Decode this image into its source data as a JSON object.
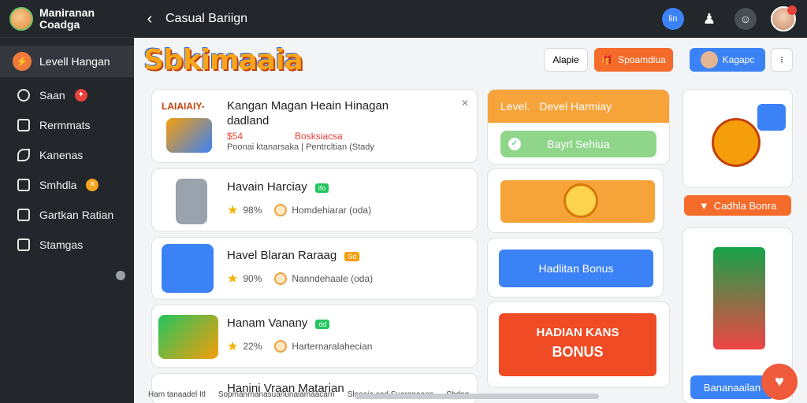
{
  "brand": {
    "line1": "Maniranan",
    "line2": "Coadga"
  },
  "header": {
    "title": "Casual Bariign",
    "pill": "lin"
  },
  "sidebar": {
    "active": {
      "label": "Levell Hangan"
    },
    "items": [
      {
        "label": "Saan"
      },
      {
        "label": "Rermmats"
      },
      {
        "label": "Kanenas"
      },
      {
        "label": "Smhdla"
      },
      {
        "label": "Gartkan Ratian"
      },
      {
        "label": "Stamgas"
      }
    ]
  },
  "toolbar": {
    "logo_text": "Sbkimaaia",
    "btn1": "Alapie",
    "btn2": "Spoamdiua",
    "btn3": "Kagapc"
  },
  "list": [
    {
      "title": "Kangan Magan Heain Hinagan",
      "title2": "dadland",
      "tag": "LAIAIAIY-",
      "price": "$54",
      "price2": "Bosksiacsa",
      "desc": "Poonai ktanarsaka | Pentrcltian (Stady"
    },
    {
      "title": "Havain Harciay",
      "badge": "ifo",
      "rating": "98%",
      "meta": "Homdehiarar (oda)"
    },
    {
      "title": "Havel Blaran Raraag",
      "badge": "Sd",
      "rating": "90%",
      "meta": "Nanndehaale (oda)"
    },
    {
      "title": "Hanam Vanany",
      "badge": "dd",
      "rating": "22%",
      "meta": "Harternaralahecian"
    },
    {
      "title": "Hanini Vraan Matarian"
    }
  ],
  "panel": {
    "level_label": "Level.",
    "level_title": "Devel Harmiay",
    "green_btn": "Bayrl Sehiua",
    "blue_btn": "Hadlitan Bonus",
    "promo_line1": "HADIAN KANS",
    "promo_line2": "BONUS"
  },
  "right": {
    "bonus_btn": "Cadhla Bonra",
    "bottom_btn": "Bananaailan"
  },
  "footer": {
    "text1": "Ham tanaadel Itl",
    "text2": "Sopmanrnanasuanunalamaacarn",
    "text3": "Slooaio sad Suaranaaen",
    "text4": "Sbdng"
  },
  "colors": {
    "accent_orange": "#f46b2a",
    "accent_blue": "#3b82f6",
    "accent_green": "#8fd68a",
    "sidebar_bg": "#23262b"
  }
}
